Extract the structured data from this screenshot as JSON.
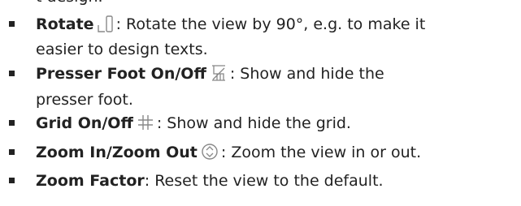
{
  "top_fragment": "t design.",
  "colors": {
    "text": "#222222",
    "icon": "#888888",
    "bullet": "#222222"
  },
  "items": [
    {
      "title": "Rotate",
      "icon": "rotate-icon",
      "line1": ": Rotate the view by 90°, e.g. to make it",
      "line2": "easier to design texts."
    },
    {
      "title": "Presser Foot On/Off",
      "icon": "presser-foot-icon",
      "line1": ": Show and hide the",
      "line2": "presser foot."
    },
    {
      "title": "Grid On/Off",
      "icon": "grid-icon",
      "line1": ": Show and hide the grid."
    },
    {
      "title": "Zoom In/Zoom Out",
      "icon": "zoom-icon",
      "line1": ": Zoom the view in or out."
    },
    {
      "title": "Zoom Factor",
      "line1": ": Reset the view to the default."
    }
  ]
}
